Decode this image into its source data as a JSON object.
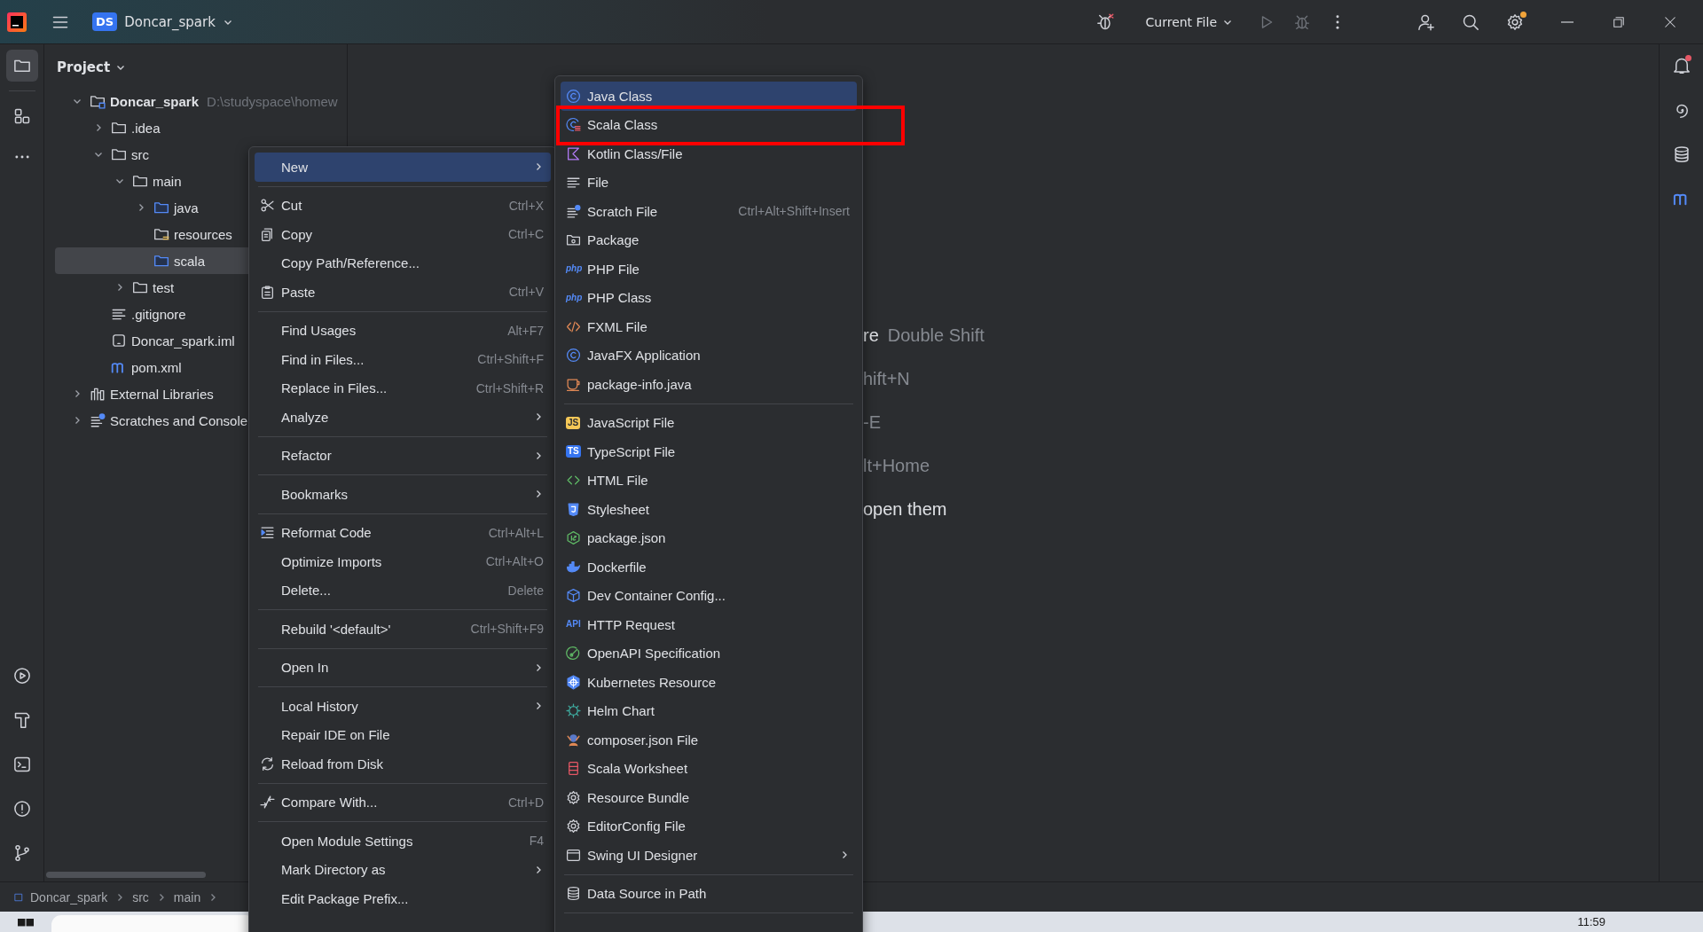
{
  "title_bar": {
    "project_badge": "DS",
    "project_name": "Doncar_spark",
    "run_config": "Current File",
    "actions": [
      {
        "kind": "run",
        "disabled": true
      },
      {
        "kind": "debug",
        "disabled": true
      },
      {
        "kind": "more"
      }
    ],
    "tools": [
      {
        "kind": "add-user"
      },
      {
        "kind": "search"
      },
      {
        "kind": "settings",
        "dot": true
      }
    ]
  },
  "left_toolbar": {
    "top": [
      {
        "kind": "folder",
        "selected": true
      },
      {
        "kind": "structure",
        "selected": false
      },
      {
        "kind": "more",
        "selected": false
      }
    ],
    "bottom": [
      {
        "kind": "run",
        "selected": false
      },
      {
        "kind": "build",
        "selected": false
      },
      {
        "kind": "terminal",
        "selected": false
      },
      {
        "kind": "problems",
        "selected": false
      },
      {
        "kind": "git",
        "selected": false
      }
    ]
  },
  "right_toolbar": [
    {
      "kind": "bell",
      "dot": true
    },
    {
      "kind": "spiral"
    },
    {
      "kind": "database"
    },
    {
      "kind": "maven"
    }
  ],
  "project_panel": {
    "title": "Project",
    "tree": [
      {
        "label": "Doncar_spark",
        "path": "D:\\studyspace\\homew",
        "kind": "module",
        "expanded": true,
        "selected": false,
        "children": [
          {
            "label": ".idea",
            "kind": "folder",
            "expanded": false,
            "selected": false
          },
          {
            "label": "src",
            "kind": "folder",
            "expanded": true,
            "selected": false,
            "children": [
              {
                "label": "main",
                "kind": "folder",
                "expanded": true,
                "selected": false,
                "children": [
                  {
                    "label": "java",
                    "kind": "source",
                    "expanded": false,
                    "selected": false
                  },
                  {
                    "label": "resources",
                    "kind": "resources",
                    "selected": false
                  },
                  {
                    "label": "scala",
                    "kind": "source",
                    "selected": true
                  }
                ]
              },
              {
                "label": "test",
                "kind": "folder",
                "expanded": false,
                "selected": false
              }
            ]
          },
          {
            "label": ".gitignore",
            "kind": "text",
            "selected": false
          },
          {
            "label": "Doncar_spark.iml",
            "kind": "iml",
            "selected": false
          },
          {
            "label": "pom.xml",
            "kind": "maven",
            "selected": false
          }
        ]
      },
      {
        "label": "External Libraries",
        "kind": "libraries",
        "expanded": false,
        "selected": false
      },
      {
        "label": "Scratches and Console",
        "kind": "scratches",
        "expanded": false,
        "selected": false
      }
    ]
  },
  "editor_hints": [
    {
      "action": "re",
      "shortcut": "Double Shift"
    },
    {
      "shortcut": "hift+N"
    },
    {
      "shortcut": "-E"
    },
    {
      "shortcut": "lt+Home"
    },
    {
      "action": "open them"
    }
  ],
  "context_menu": {
    "items": [
      {
        "kind": "item",
        "label": "New",
        "submenu": true,
        "selected": true
      },
      {
        "kind": "separator"
      },
      {
        "kind": "item",
        "label": "Cut",
        "shortcut": "Ctrl+X",
        "selected": false
      },
      {
        "kind": "item",
        "label": "Copy",
        "shortcut": "Ctrl+C",
        "selected": false
      },
      {
        "kind": "item",
        "label": "Copy Path/Reference...",
        "selected": false
      },
      {
        "kind": "item",
        "label": "Paste",
        "shortcut": "Ctrl+V",
        "selected": false
      },
      {
        "kind": "separator"
      },
      {
        "kind": "item",
        "label": "Find Usages",
        "shortcut": "Alt+F7",
        "selected": false
      },
      {
        "kind": "item",
        "label": "Find in Files...",
        "shortcut": "Ctrl+Shift+F",
        "selected": false
      },
      {
        "kind": "item",
        "label": "Replace in Files...",
        "shortcut": "Ctrl+Shift+R",
        "selected": false
      },
      {
        "kind": "item",
        "label": "Analyze",
        "submenu": true,
        "selected": false
      },
      {
        "kind": "separator"
      },
      {
        "kind": "item",
        "label": "Refactor",
        "submenu": true,
        "selected": false
      },
      {
        "kind": "separator"
      },
      {
        "kind": "item",
        "label": "Bookmarks",
        "submenu": true,
        "selected": false
      },
      {
        "kind": "separator"
      },
      {
        "kind": "item",
        "label": "Reformat Code",
        "shortcut": "Ctrl+Alt+L",
        "selected": false
      },
      {
        "kind": "item",
        "label": "Optimize Imports",
        "shortcut": "Ctrl+Alt+O",
        "selected": false
      },
      {
        "kind": "item",
        "label": "Delete...",
        "shortcut": "Delete",
        "selected": false
      },
      {
        "kind": "separator"
      },
      {
        "kind": "item",
        "label": "Rebuild '<default>'",
        "shortcut": "Ctrl+Shift+F9",
        "selected": false
      },
      {
        "kind": "separator"
      },
      {
        "kind": "item",
        "label": "Open In",
        "submenu": true,
        "selected": false
      },
      {
        "kind": "separator"
      },
      {
        "kind": "item",
        "label": "Local History",
        "submenu": true,
        "selected": false
      },
      {
        "kind": "item",
        "label": "Repair IDE on File",
        "selected": false
      },
      {
        "kind": "item",
        "label": "Reload from Disk",
        "selected": false
      },
      {
        "kind": "separator"
      },
      {
        "kind": "item",
        "label": "Compare With...",
        "shortcut": "Ctrl+D",
        "selected": false
      },
      {
        "kind": "separator"
      },
      {
        "kind": "item",
        "label": "Open Module Settings",
        "shortcut": "F4",
        "selected": false
      },
      {
        "kind": "item",
        "label": "Mark Directory as",
        "submenu": true,
        "selected": false
      },
      {
        "kind": "item",
        "label": "Edit Package Prefix...",
        "selected": false
      }
    ]
  },
  "new_submenu": {
    "items": [
      {
        "kind": "item",
        "label": "Java Class",
        "selected": true
      },
      {
        "kind": "item",
        "label": "Scala Class",
        "selected": false
      },
      {
        "kind": "item",
        "label": "Kotlin Class/File",
        "selected": false
      },
      {
        "kind": "item",
        "label": "File",
        "selected": false
      },
      {
        "kind": "item",
        "label": "Scratch File",
        "shortcut": "Ctrl+Alt+Shift+Insert",
        "selected": false
      },
      {
        "kind": "item",
        "label": "Package",
        "selected": false
      },
      {
        "kind": "item",
        "label": "PHP File",
        "badge": "php",
        "selected": false
      },
      {
        "kind": "item",
        "label": "PHP Class",
        "badge": "php",
        "selected": false
      },
      {
        "kind": "item",
        "label": "FXML File",
        "selected": false
      },
      {
        "kind": "item",
        "label": "JavaFX Application",
        "selected": false
      },
      {
        "kind": "item",
        "label": "package-info.java",
        "selected": false
      },
      {
        "kind": "separator"
      },
      {
        "kind": "item",
        "label": "JavaScript File",
        "badge": "JS",
        "selected": false
      },
      {
        "kind": "item",
        "label": "TypeScript File",
        "badge": "TS",
        "selected": false
      },
      {
        "kind": "item",
        "label": "HTML File",
        "selected": false
      },
      {
        "kind": "item",
        "label": "Stylesheet",
        "selected": false
      },
      {
        "kind": "item",
        "label": "package.json",
        "selected": false
      },
      {
        "kind": "item",
        "label": "Dockerfile",
        "selected": false
      },
      {
        "kind": "item",
        "label": "Dev Container Config...",
        "selected": false
      },
      {
        "kind": "item",
        "label": "HTTP Request",
        "badge": "API",
        "selected": false
      },
      {
        "kind": "item",
        "label": "OpenAPI Specification",
        "selected": false
      },
      {
        "kind": "item",
        "label": "Kubernetes Resource",
        "selected": false
      },
      {
        "kind": "item",
        "label": "Helm Chart",
        "selected": false
      },
      {
        "kind": "item",
        "label": "composer.json File",
        "selected": false
      },
      {
        "kind": "item",
        "label": "Scala Worksheet",
        "selected": false
      },
      {
        "kind": "item",
        "label": "Resource Bundle",
        "selected": false
      },
      {
        "kind": "item",
        "label": "EditorConfig File",
        "selected": false
      },
      {
        "kind": "item",
        "label": "Swing UI Designer",
        "submenu": true,
        "selected": false
      },
      {
        "kind": "separator"
      },
      {
        "kind": "item",
        "label": "Data Source in Path",
        "selected": false
      },
      {
        "kind": "separator"
      }
    ]
  },
  "status_bar": {
    "breadcrumbs": [
      "Doncar_spark",
      "src",
      "main"
    ]
  },
  "taskbar": {
    "time": "11:59"
  }
}
